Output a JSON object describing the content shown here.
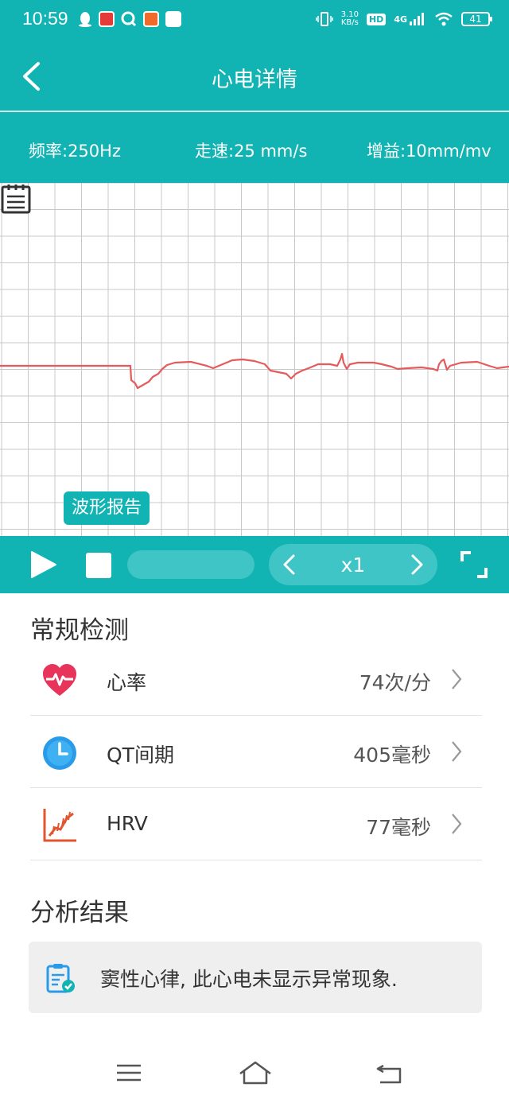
{
  "status_bar": {
    "time": "10:59",
    "net_speed": "3.10",
    "net_unit": "KB/s",
    "hd": "HD",
    "network": "4G",
    "battery": "41"
  },
  "header": {
    "title": "心电详情"
  },
  "params": {
    "frequency": "频率:250Hz",
    "speed": "走速:25 mm/s",
    "gain": "增益:10mm/mv"
  },
  "ecg": {
    "report_button": "波形报告",
    "trace_color": "#e55a5a",
    "grid_color": "#c8c8c8"
  },
  "controls": {
    "speed_label": "x1",
    "progress_fraction": 0.0
  },
  "routine": {
    "title": "常规检测",
    "items": [
      {
        "label": "心率",
        "value": "74次/分",
        "icon": "heart-rate-icon"
      },
      {
        "label": "QT间期",
        "value": "405毫秒",
        "icon": "clock-icon"
      },
      {
        "label": "HRV",
        "value": "77毫秒",
        "icon": "hrv-chart-icon"
      }
    ]
  },
  "analysis": {
    "title": "分析结果",
    "result": "窦性心律, 此心电未显示异常现象."
  },
  "colors": {
    "brand": "#12b3b3",
    "heart": "#e8335a",
    "clock": "#2a9be8",
    "hrv": "#e2552f"
  }
}
